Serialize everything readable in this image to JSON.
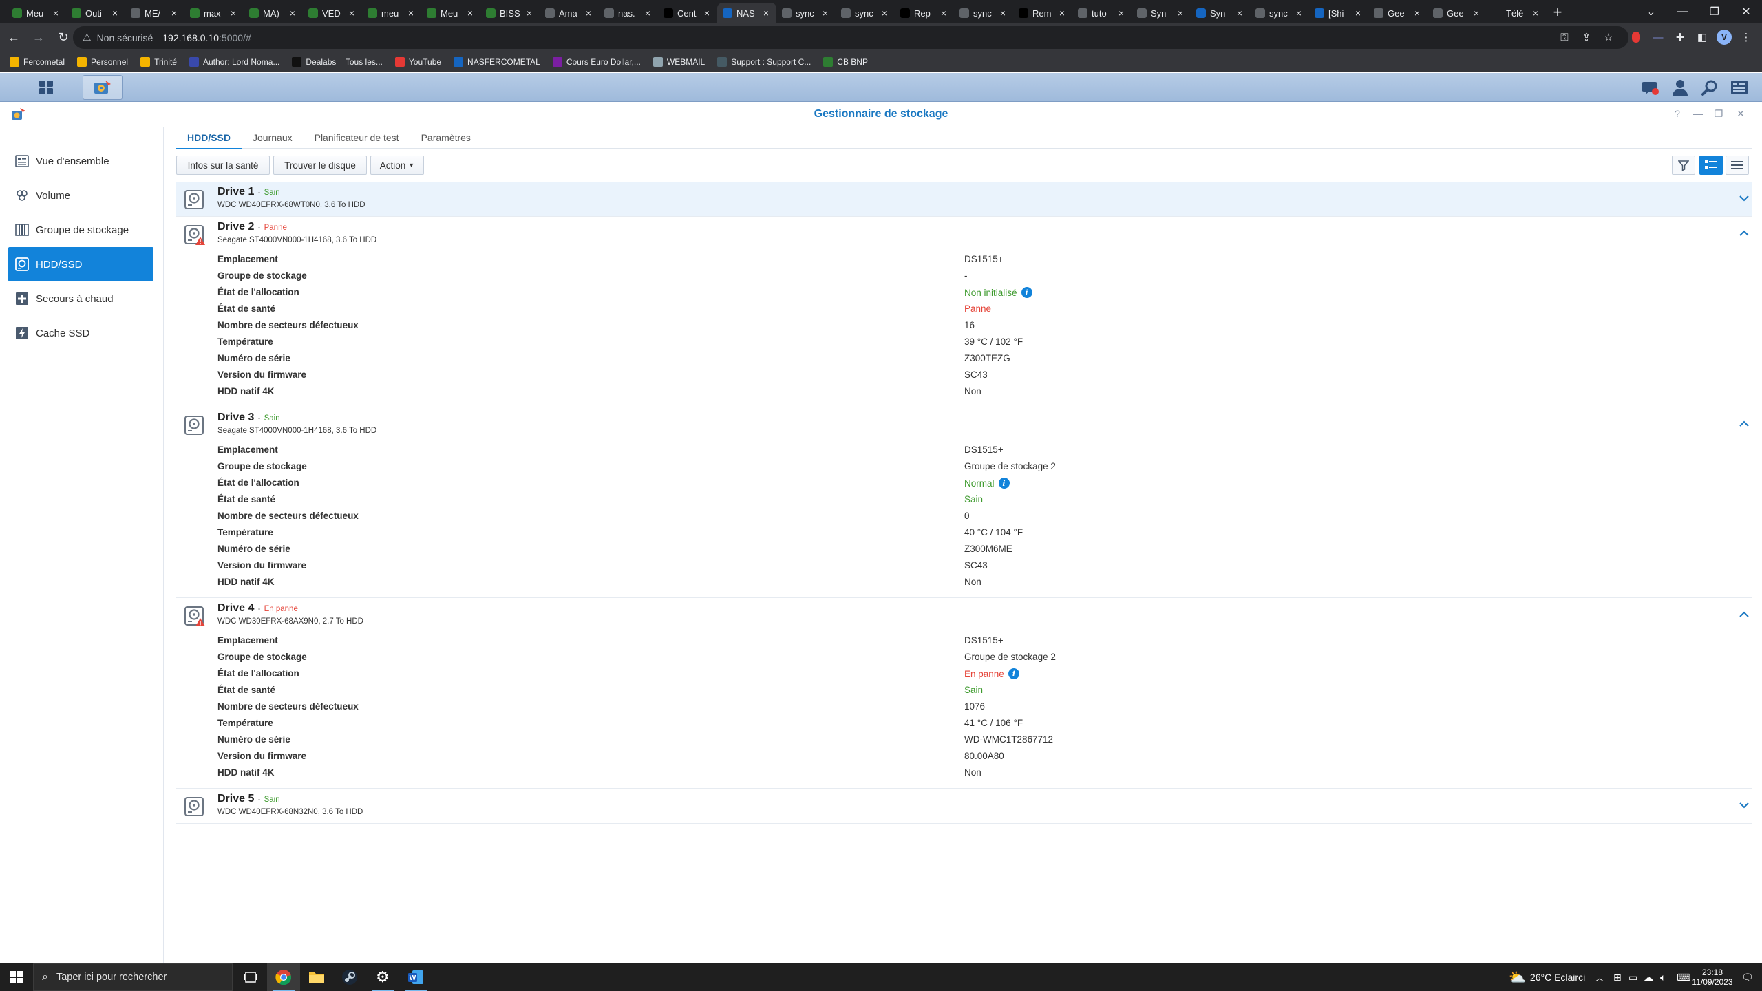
{
  "browser": {
    "tabs": [
      {
        "label": "Meu",
        "color": "#2e7d32"
      },
      {
        "label": "Outi",
        "color": "#2e7d32"
      },
      {
        "label": "ME/",
        "color": "#5f6368"
      },
      {
        "label": "max",
        "color": "#2e7d32"
      },
      {
        "label": "MA)",
        "color": "#2e7d32"
      },
      {
        "label": "VED",
        "color": "#2e7d32"
      },
      {
        "label": "meu",
        "color": "#2e7d32"
      },
      {
        "label": "Meu",
        "color": "#2e7d32"
      },
      {
        "label": "BISS",
        "color": "#2e7d32"
      },
      {
        "label": "Ama",
        "color": "#5f6368"
      },
      {
        "label": "nas.",
        "color": "#5f6368"
      },
      {
        "label": "Cent",
        "color": "#000000"
      },
      {
        "label": "NAS",
        "color": "#1565c0"
      },
      {
        "label": "sync",
        "color": "#5f6368"
      },
      {
        "label": "sync",
        "color": "#5f6368"
      },
      {
        "label": "Rep",
        "color": "#000000"
      },
      {
        "label": "sync",
        "color": "#5f6368"
      },
      {
        "label": "Rem",
        "color": "#000000"
      },
      {
        "label": "tuto",
        "color": "#5f6368"
      },
      {
        "label": "Syn",
        "color": "#5f6368"
      },
      {
        "label": "Syn",
        "color": "#1565c0"
      },
      {
        "label": "sync",
        "color": "#5f6368"
      },
      {
        "label": "[Shi",
        "color": "#1565c0"
      },
      {
        "label": "Gee",
        "color": "#5f6368"
      },
      {
        "label": "Gee",
        "color": "#5f6368"
      },
      {
        "label": "Télé",
        "color": "#202124"
      }
    ],
    "active_tab_index": 12,
    "new_tab": "+",
    "address": {
      "warning": "Non sécurisé",
      "url_host": "192.168.0.10",
      "url_rest": ":5000/#"
    },
    "profile_initial": "V",
    "bookmarks": [
      {
        "label": "Fercometal",
        "color": "#f4b400"
      },
      {
        "label": "Personnel",
        "color": "#f4b400"
      },
      {
        "label": "Trinité",
        "color": "#f4b400"
      },
      {
        "label": "Author: Lord Noma...",
        "color": "#3949ab"
      },
      {
        "label": "Dealabs = Tous les...",
        "color": "#111111"
      },
      {
        "label": "YouTube",
        "color": "#e53935"
      },
      {
        "label": "NASFERCOMETAL",
        "color": "#1565c0"
      },
      {
        "label": "Cours Euro Dollar,...",
        "color": "#7b1fa2"
      },
      {
        "label": "WEBMAIL",
        "color": "#90a4ae"
      },
      {
        "label": "Support : Support C...",
        "color": "#455a64"
      },
      {
        "label": "CB BNP",
        "color": "#2e7d32"
      }
    ]
  },
  "app": {
    "title": "Gestionnaire de stockage",
    "sidebar": [
      {
        "label": "Vue d'ensemble",
        "icon": "overview-icon"
      },
      {
        "label": "Volume",
        "icon": "volume-icon"
      },
      {
        "label": "Groupe de stockage",
        "icon": "storage-pool-icon"
      },
      {
        "label": "HDD/SSD",
        "icon": "hdd-icon"
      },
      {
        "label": "Secours à chaud",
        "icon": "hot-spare-icon"
      },
      {
        "label": "Cache SSD",
        "icon": "ssd-cache-icon"
      }
    ],
    "sidebar_active_index": 3,
    "tabs": [
      "HDD/SSD",
      "Journaux",
      "Planificateur de test",
      "Paramètres"
    ],
    "active_tab_index": 0,
    "toolbar": {
      "health_info": "Infos sur la santé",
      "find_disk": "Trouver le disque",
      "action": "Action"
    },
    "field_labels": [
      "Emplacement",
      "Groupe de stockage",
      "État de l'allocation",
      "État de santé",
      "Nombre de secteurs défectueux",
      "Température",
      "Numéro de série",
      "Version du firmware",
      "HDD natif 4K"
    ],
    "drives": [
      {
        "name": "Drive 1",
        "status": "Sain",
        "status_color": "#3d9a2d",
        "model": "WDC WD40EFRX-68WT0N0, 3.6 To HDD",
        "warning": false,
        "expanded": false,
        "values": []
      },
      {
        "name": "Drive 2",
        "status": "Panne",
        "status_color": "#e5453a",
        "model": "Seagate ST4000VN000-1H4168, 3.6 To HDD",
        "warning": true,
        "expanded": true,
        "values": [
          {
            "text": "DS1515+"
          },
          {
            "text": "-"
          },
          {
            "text": "Non initialisé",
            "color": "#3d9a2d",
            "info": true
          },
          {
            "text": "Panne",
            "color": "#e5453a"
          },
          {
            "text": "16"
          },
          {
            "text": "39 °C / 102 °F"
          },
          {
            "text": "Z300TEZG"
          },
          {
            "text": "SC43"
          },
          {
            "text": "Non"
          }
        ]
      },
      {
        "name": "Drive 3",
        "status": "Sain",
        "status_color": "#3d9a2d",
        "model": "Seagate ST4000VN000-1H4168, 3.6 To HDD",
        "warning": false,
        "expanded": true,
        "values": [
          {
            "text": "DS1515+"
          },
          {
            "text": "Groupe de stockage 2"
          },
          {
            "text": "Normal",
            "color": "#3d9a2d",
            "info": true
          },
          {
            "text": "Sain",
            "color": "#3d9a2d"
          },
          {
            "text": "0"
          },
          {
            "text": "40 °C / 104 °F"
          },
          {
            "text": "Z300M6ME"
          },
          {
            "text": "SC43"
          },
          {
            "text": "Non"
          }
        ]
      },
      {
        "name": "Drive 4",
        "status": "En panne",
        "status_color": "#e5453a",
        "model": "WDC WD30EFRX-68AX9N0, 2.7 To HDD",
        "warning": true,
        "expanded": true,
        "values": [
          {
            "text": "DS1515+"
          },
          {
            "text": "Groupe de stockage 2"
          },
          {
            "text": "En panne",
            "color": "#e5453a",
            "info": true
          },
          {
            "text": "Sain",
            "color": "#3d9a2d"
          },
          {
            "text": "1076"
          },
          {
            "text": "41 °C / 106 °F"
          },
          {
            "text": "WD-WMC1T2867712"
          },
          {
            "text": "80.00A80"
          },
          {
            "text": "Non"
          }
        ]
      },
      {
        "name": "Drive 5",
        "status": "Sain",
        "status_color": "#3d9a2d",
        "model": "WDC WD40EFRX-68N32N0, 3.6 To HDD",
        "warning": false,
        "expanded": false,
        "values": []
      }
    ]
  },
  "taskbar": {
    "search_placeholder": "Taper ici pour rechercher",
    "weather": "26°C Eclairci",
    "time": "23:18",
    "date": "11/09/2023"
  }
}
